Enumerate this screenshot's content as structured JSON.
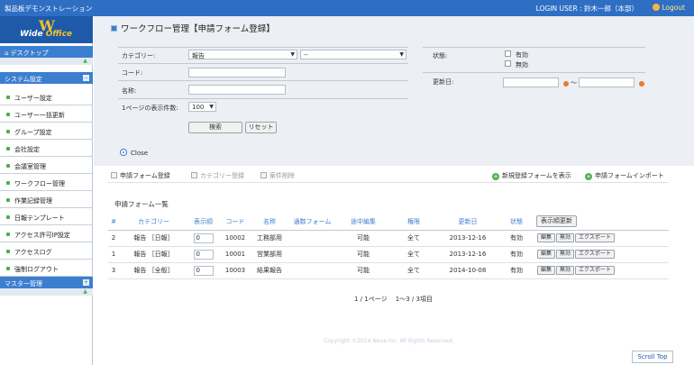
{
  "header": {
    "system_name": "製品板デモンストレーション",
    "login_user": "LOGIN USER : 鈴木一郎（本部）",
    "logout_label": "Logout"
  },
  "logo": {
    "letter": "W",
    "text1": "Wide",
    "text2": "Office"
  },
  "sidebar": {
    "desktop_label": "デスクトップ",
    "system_section": "システム設定",
    "items": [
      "ユーザー設定",
      "ユーザー一括更新",
      "グループ設定",
      "会社設定",
      "会議室管理",
      "ワークフロー管理",
      "作業記録管理",
      "日報テンプレート",
      "アクセス許可IP設定",
      "アクセスログ",
      "強制ログアウト"
    ],
    "master_section": "マスター管理"
  },
  "page": {
    "title": "ワークフロー管理【申請フォーム登録】"
  },
  "search": {
    "category_label": "カテゴリー:",
    "category_value": "報告",
    "subcategory_value": "--",
    "code_label": "コード:",
    "name_label": "名称:",
    "per_page_label": "1ページの表示件数:",
    "per_page_value": "100",
    "status_label": "状態:",
    "status_enabled": "有効",
    "status_disabled": "無効",
    "updated_label": "更新日:",
    "range_sep": "～",
    "search_button": "検索",
    "reset_button": "リセット",
    "close_label": "Close"
  },
  "toolbar": {
    "tab_form": "申請フォーム登録",
    "tab_category": "カテゴリー登録",
    "tab_delete": "案件削除",
    "new_form": "新規登録フォームを表示",
    "import_form": "申請フォームインポート"
  },
  "list": {
    "title": "申請フォーム一覧",
    "columns": [
      "#",
      "カテゴリー",
      "表示順",
      "コード",
      "名称",
      "通数フォーム",
      "途中編集",
      "権限",
      "更新日",
      "状態"
    ],
    "header_button": "表示順更新",
    "rows": [
      {
        "no": "2",
        "category": "報告 ［日報］",
        "order": "0",
        "code": "10002",
        "name": "工務部用",
        "count_form": "",
        "midedit": "可能",
        "auth": "全て",
        "updated": "2013-12-16",
        "status": "有効"
      },
      {
        "no": "1",
        "category": "報告 ［日報］",
        "order": "0",
        "code": "10001",
        "name": "営業部用",
        "count_form": "",
        "midedit": "可能",
        "auth": "全て",
        "updated": "2013-12-16",
        "status": "有効"
      },
      {
        "no": "3",
        "category": "報告 ［全般］",
        "order": "0",
        "code": "10003",
        "name": "結果報告",
        "count_form": "",
        "midedit": "可能",
        "auth": "全て",
        "updated": "2014-10-08",
        "status": "有効"
      }
    ],
    "row_buttons": {
      "edit": "編集",
      "disable": "無効",
      "export": "エクスポート"
    }
  },
  "pager": {
    "text": "1 / 1ページ　 1～3 / 3項目"
  },
  "footer": {
    "copyright": "Copyright ©2014 Neoa Inc. All Rights Reserved.",
    "scroll_top": "Scroll Top"
  }
}
